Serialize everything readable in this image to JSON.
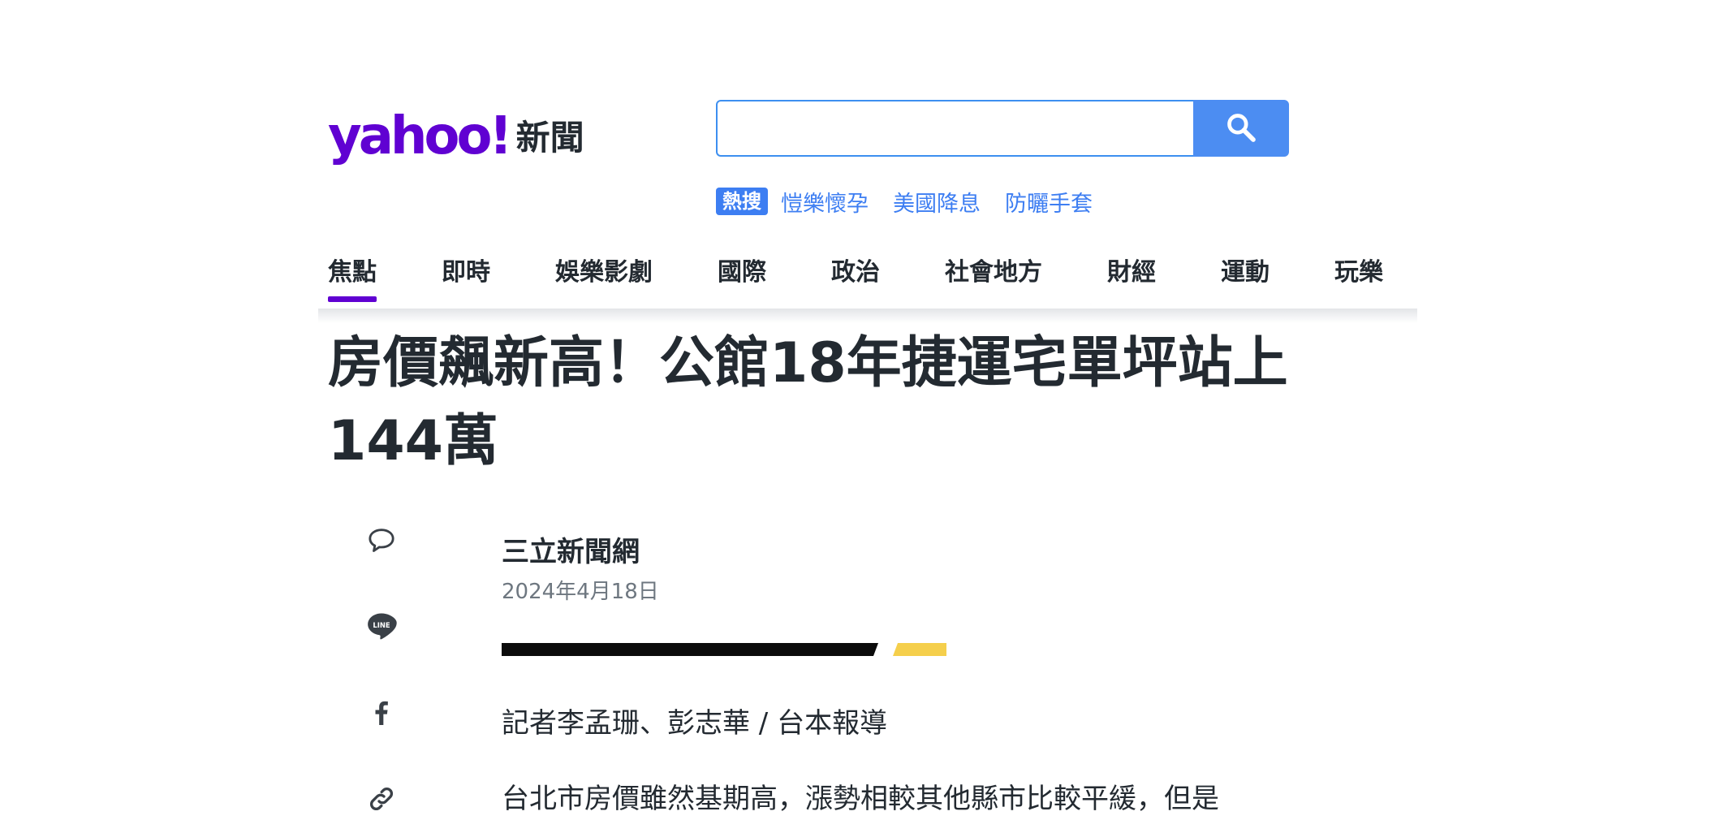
{
  "header": {
    "logo_brand": "yahoo!",
    "logo_section": "新聞",
    "search": {
      "value": "",
      "placeholder": ""
    },
    "trending": {
      "badge": "熱搜",
      "items": [
        "愷樂懷孕",
        "美國降息",
        "防曬手套"
      ]
    }
  },
  "nav": {
    "items": [
      {
        "label": "焦點",
        "active": true
      },
      {
        "label": "即時"
      },
      {
        "label": "娛樂影劇"
      },
      {
        "label": "國際"
      },
      {
        "label": "政治"
      },
      {
        "label": "社會地方"
      },
      {
        "label": "財經"
      },
      {
        "label": "運動"
      },
      {
        "label": "玩樂"
      }
    ]
  },
  "article": {
    "headline_line1": "房價飆新高！公館18年捷運宅單坪站上",
    "headline_line2": "144萬",
    "source": "三立新聞網",
    "date": "2024年4月18日",
    "byline": "記者李孟珊、彭志華 / 台本報導",
    "body_first_line": "台北市房價雖然基期高，漲勢相較其他縣市比較平緩，但是"
  },
  "share_icons": [
    "comment-icon",
    "line-icon",
    "facebook-icon",
    "link-icon"
  ],
  "colors": {
    "brand_purple": "#6001d2",
    "search_blue": "#4c8df2",
    "link_blue": "#3d7ef2",
    "text_dark": "#232a31",
    "text_muted": "#6e7780",
    "accent_yellow": "#f5cf4c"
  }
}
